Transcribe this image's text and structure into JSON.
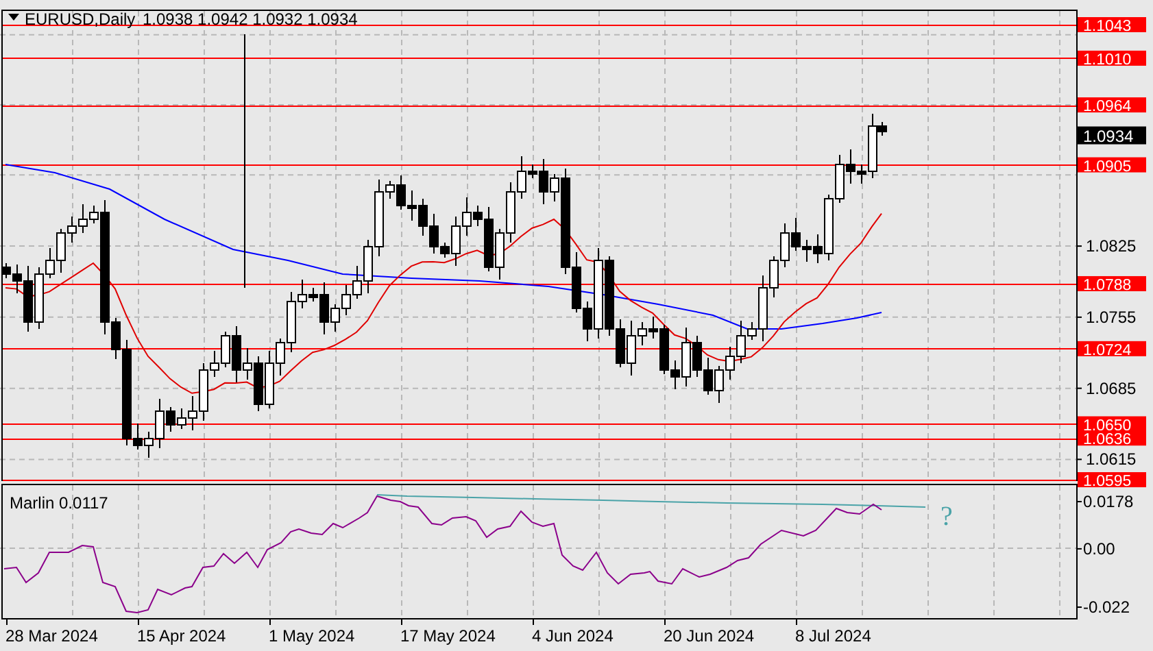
{
  "header": {
    "symbol": "EURUSD,Daily",
    "ohlc": "1.0938 1.0942 1.0932 1.0934"
  },
  "price_levels": [
    {
      "label": "1.1043"
    },
    {
      "label": "1.1010"
    },
    {
      "label": "1.0964"
    },
    {
      "label": "1.0905"
    },
    {
      "label": "1.0788"
    },
    {
      "label": "1.0724"
    },
    {
      "label": "1.0650"
    },
    {
      "label": "1.0636"
    },
    {
      "label": "1.0595"
    }
  ],
  "current_price": "1.0934",
  "price_axis": {
    "ticks": [
      "1.0825",
      "1.0755",
      "1.0685",
      "1.0615"
    ]
  },
  "indicator": {
    "label": "Marlin 0.0117",
    "annotation": "?",
    "ticks": [
      "0.0178",
      "0.00",
      "-0.022"
    ]
  },
  "date_axis": [
    "28 Mar 2024",
    "15 Apr 2024",
    "1 May 2024",
    "17 May 2024",
    "4 Jun 2024",
    "20 Jun 2024",
    "8 Jul 2024"
  ]
}
